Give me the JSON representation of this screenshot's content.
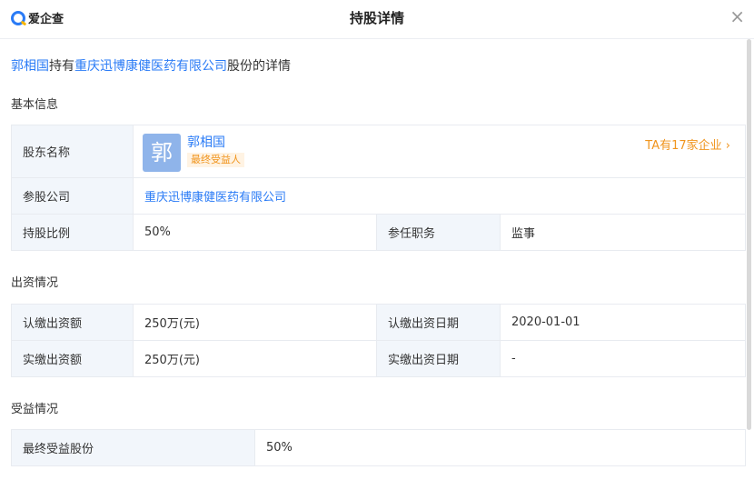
{
  "header": {
    "logo_text": "爱企查",
    "title": "持股详情",
    "close_label": "×"
  },
  "summary": {
    "person": "郭相国",
    "mid": "持有",
    "company": "重庆迅博康健医药有限公司",
    "tail": "股份的详情"
  },
  "basic": {
    "title": "基本信息",
    "shareholder_label": "股东名称",
    "avatar_char": "郭",
    "holder_name": "郭相国",
    "holder_badge": "最终受益人",
    "ta_link": "TA有17家企业 ›",
    "company_label": "参股公司",
    "company_value": "重庆迅博康健医药有限公司",
    "ratio_label": "持股比例",
    "ratio_value": "50%",
    "role_label": "参任职务",
    "role_value": "监事"
  },
  "capital": {
    "title": "出资情况",
    "sub_amount_label": "认缴出资额",
    "sub_amount_value": "250万(元)",
    "sub_date_label": "认缴出资日期",
    "sub_date_value": "2020-01-01",
    "paid_amount_label": "实缴出资额",
    "paid_amount_value": "250万(元)",
    "paid_date_label": "实缴出资日期",
    "paid_date_value": "-"
  },
  "benefit": {
    "title": "受益情况",
    "final_label": "最终受益股份",
    "final_value": "50%"
  }
}
